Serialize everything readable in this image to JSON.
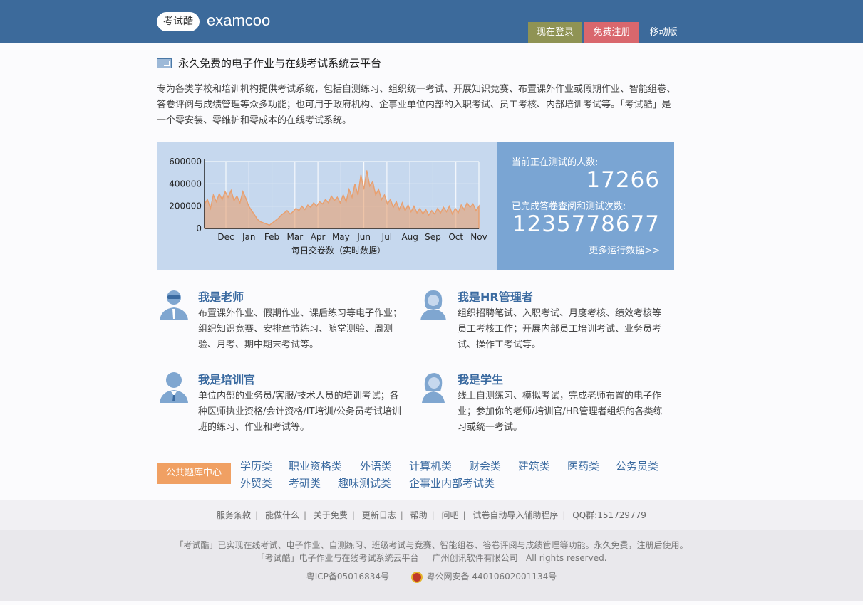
{
  "header": {
    "logo_badge": "考试酷",
    "logo_text": "examcoo",
    "login_label": "现在登录",
    "register_label": "免费注册",
    "mobile_label": "移动版"
  },
  "intro": {
    "title": "永久免费的电子作业与在线考试系统云平台",
    "description": "专为各类学校和培训机构提供考试系统，包括自测练习、组织统一考试、开展知识竞赛、布置课外作业或假期作业、智能组卷、答卷评阅与成绩管理等众多功能；也可用于政府机构、企事业单位内部的入职考试、员工考核、内部培训考试等。「考试酷」是一个零安装、零维护和零成本的在线考试系统。"
  },
  "stats": {
    "current_label": "当前正在测试的人数:",
    "current_value": "17266",
    "total_label": "已完成答卷查阅和测试次数:",
    "total_value": "1235778677",
    "more_link": "更多运行数据>>"
  },
  "chart_data": {
    "type": "area",
    "xlabel": "每日交卷数（实时数据）",
    "ylabel": "",
    "ylim": [
      0,
      600000
    ],
    "yticks": [
      "0",
      "200000",
      "400000",
      "600000"
    ],
    "xticks": [
      "Dec",
      "Jan",
      "Feb",
      "Mar",
      "Apr",
      "May",
      "Jun",
      "Jul",
      "Aug",
      "Sep",
      "Oct",
      "Nov"
    ],
    "grid": true,
    "color": "#e8a070",
    "series": [
      {
        "values": [
          220000,
          260000,
          180000,
          300000,
          240000,
          310000,
          260000,
          330000,
          280000,
          340000,
          250000,
          290000,
          230000,
          330000,
          270000,
          200000,
          160000,
          120000,
          80000,
          60000,
          50000,
          40000,
          30000,
          50000,
          70000,
          90000,
          120000,
          140000,
          160000,
          130000,
          150000,
          180000,
          160000,
          200000,
          170000,
          210000,
          190000,
          230000,
          200000,
          240000,
          220000,
          260000,
          230000,
          290000,
          250000,
          280000,
          230000,
          300000,
          240000,
          350000,
          280000,
          400000,
          300000,
          480000,
          350000,
          520000,
          380000,
          420000,
          300000,
          350000,
          260000,
          300000,
          220000,
          260000,
          190000,
          240000,
          170000,
          230000,
          160000,
          210000,
          150000,
          200000,
          140000,
          180000,
          130000,
          170000,
          120000,
          160000,
          130000,
          180000,
          140000,
          190000,
          150000,
          200000,
          130000,
          180000,
          140000,
          210000,
          170000,
          230000,
          190000,
          220000,
          160000,
          200000
        ]
      }
    ]
  },
  "roles": [
    {
      "title": "我是老师",
      "desc": "布置课外作业、假期作业、课后练习等电子作业；组织知识竞赛、安排章节练习、随堂测验、周测验、月考、期中期末考试等。",
      "icon": "teacher-icon"
    },
    {
      "title": "我是HR管理者",
      "desc": "组织招聘笔试、入职考试、月度考核、绩效考核等员工考核工作；开展内部员工培训考试、业务员考试、操作工考试等。",
      "icon": "hr-manager-icon"
    },
    {
      "title": "我是培训官",
      "desc": "单位内部的业务员/客服/技术人员的培训考试；各种医师执业资格/会计资格/IT培训/公务员考试培训班的练习、作业和考试等。",
      "icon": "trainer-icon"
    },
    {
      "title": "我是学生",
      "desc": "线上自测练习、模拟考试，完成老师布置的电子作业；参加你的老师/培训官/HR管理者组织的各类练习或统一考试。",
      "icon": "student-icon"
    }
  ],
  "bank": {
    "button_label": "公共题库中心",
    "categories": [
      "学历类",
      "职业资格类",
      "外语类",
      "计算机类",
      "财会类",
      "建筑类",
      "医药类",
      "公务员类",
      "外贸类",
      "考研类",
      "趣味测试类",
      "企事业内部考试类"
    ]
  },
  "footer": {
    "links": [
      "服务条款",
      "能做什么",
      "关于免费",
      "更新日志",
      "帮助",
      "问吧",
      "试卷自动导入辅助程序",
      "QQ群:151729779"
    ],
    "line1": "「考试酷」已实现在线考试、电子作业、自测练习、班级考试与竞赛、智能组卷、答卷评阅与成绩管理等功能。永久免费，注册后使用。",
    "line2_a": "「考试酷」电子作业与在线考试系统云平台",
    "line2_b": "广州创讯软件有限公司",
    "line2_c": "All rights reserved.",
    "icp": "粤ICP备05016834号",
    "police": "粤公网安备 44010602001134号"
  }
}
